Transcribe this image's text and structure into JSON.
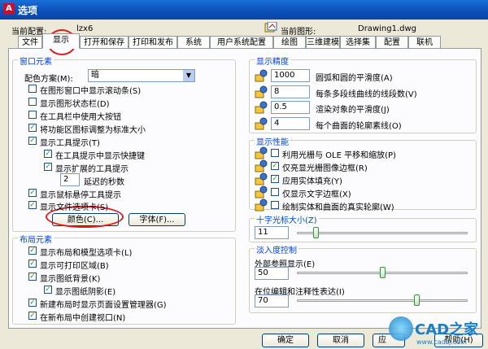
{
  "window": {
    "title": "选项",
    "app_icon": "A"
  },
  "profile_row": {
    "current_profile_label": "当前配置:",
    "current_profile_value": "lzx6",
    "current_drawing_label": "当前图形:",
    "current_drawing_value": "Drawing1.dwg"
  },
  "tabs": [
    "文件",
    "显示",
    "打开和保存",
    "打印和发布",
    "系统",
    "用户系统配置",
    "绘图",
    "三维建模",
    "选择集",
    "配置",
    "联机"
  ],
  "window_elements": {
    "title": "窗口元素",
    "color_scheme_label": "配色方案(M):",
    "color_scheme_value": "暗",
    "checks": [
      {
        "label": "在图形窗口中显示滚动条(S)",
        "checked": false
      },
      {
        "label": "显示图形状态栏(D)",
        "checked": false
      },
      {
        "label": "在工具栏中使用大按钮",
        "checked": false
      },
      {
        "label": "将功能区图标调整为标准大小",
        "checked": true
      },
      {
        "label": "显示工具提示(T)",
        "checked": true
      },
      {
        "label": "在工具提示中显示快捷键",
        "checked": true
      },
      {
        "label": "显示扩展的工具提示",
        "checked": true
      }
    ],
    "delay_value": "2",
    "delay_label": "延迟的秒数",
    "checks2": [
      {
        "label": "显示鼠标悬停工具提示",
        "checked": true
      },
      {
        "label": "显示文件选项卡(S)",
        "checked": true
      }
    ],
    "colors_button": "颜色(C)...",
    "fonts_button": "字体(F)..."
  },
  "layout_elements": {
    "title": "布局元素",
    "checks": [
      {
        "label": "显示布局和模型选项卡(L)",
        "checked": true
      },
      {
        "label": "显示可打印区域(B)",
        "checked": true
      },
      {
        "label": "显示图纸背景(K)",
        "checked": true
      },
      {
        "label": "显示图纸阴影(E)",
        "checked": true
      },
      {
        "label": "新建布局时显示页面设置管理器(G)",
        "checked": true
      },
      {
        "label": "在新布局中创建视口(N)",
        "checked": true
      }
    ]
  },
  "display_resolution": {
    "title": "显示精度",
    "rows": [
      {
        "value": "1000",
        "label": "圆弧和圆的平滑度(A)"
      },
      {
        "value": "8",
        "label": "每条多段线曲线的线段数(V)"
      },
      {
        "value": "0.5",
        "label": "渲染对象的平滑度(J)"
      },
      {
        "value": "4",
        "label": "每个曲面的轮廓素线(O)"
      }
    ]
  },
  "display_performance": {
    "title": "显示性能",
    "checks": [
      {
        "label": "利用光栅与 OLE 平移和缩放(P)",
        "checked": false
      },
      {
        "label": "仅亮显光栅图像边框(R)",
        "checked": true
      },
      {
        "label": "应用实体填充(Y)",
        "checked": true
      },
      {
        "label": "仅显示文字边框(X)",
        "checked": false
      },
      {
        "label": "绘制实体和曲面的真实轮廓(W)",
        "checked": false
      }
    ]
  },
  "crosshair": {
    "title": "十字光标大小(Z)",
    "value": "11",
    "fraction": 0.11
  },
  "fade_control": {
    "title": "淡入度控制",
    "xref_label": "外部参照显示(E)",
    "xref_value": "50",
    "xref_fraction": 0.5,
    "inplace_label": "在位编辑和注释性表达(I)",
    "inplace_value": "70",
    "inplace_fraction": 0.7
  },
  "footer": {
    "ok": "确定",
    "cancel": "取消",
    "apply": "应",
    "help": "帮助(H)"
  },
  "watermark": {
    "text": "CAD之家",
    "url": "www.cadzj.com"
  },
  "colors": {
    "title_bar": "#0a4fb8",
    "group_title": "#0046d5",
    "highlight_circle": "#d9201f",
    "check_mark": "#21a121"
  }
}
